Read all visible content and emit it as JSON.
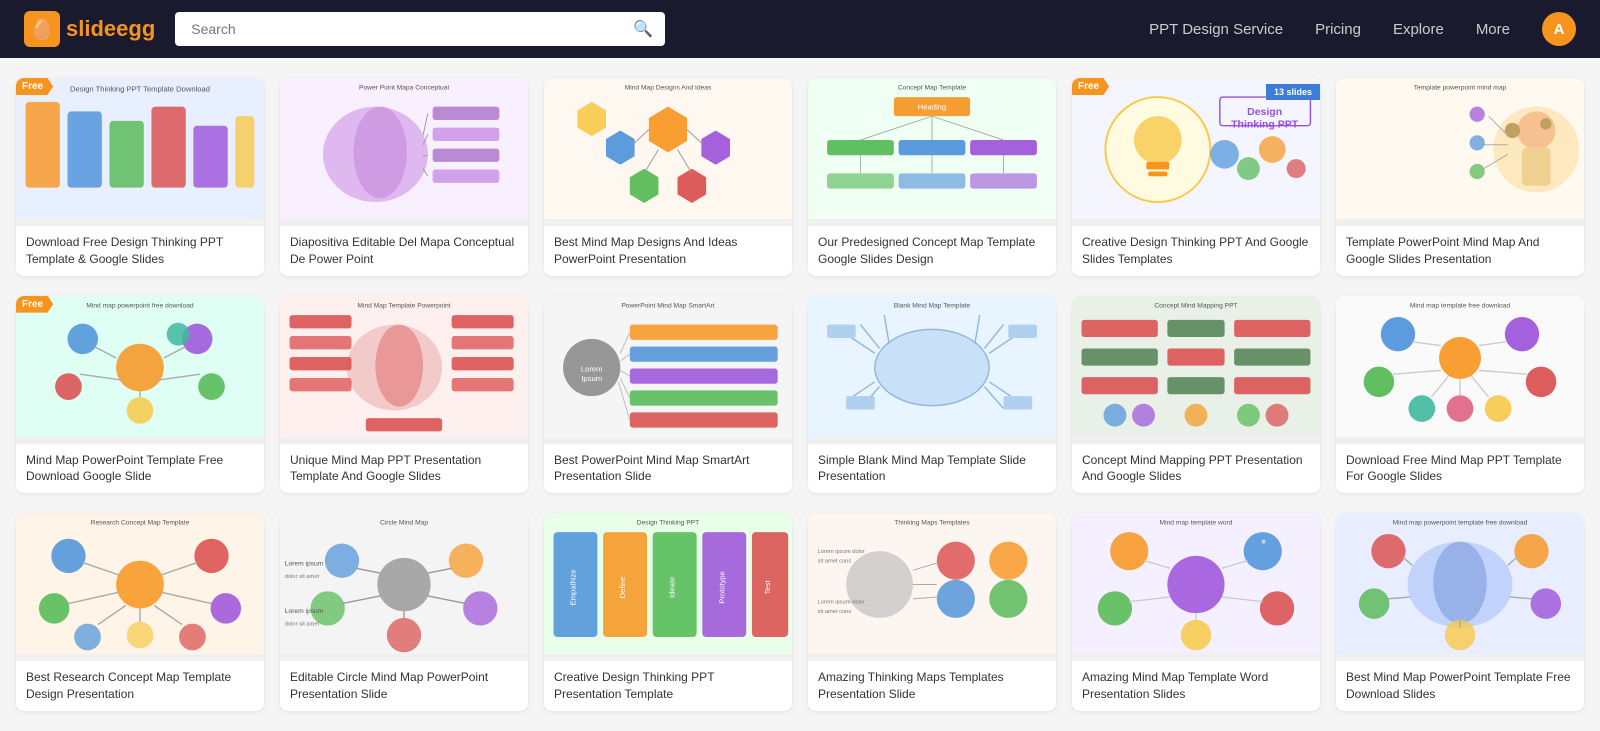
{
  "header": {
    "logo_text_slide": "slide",
    "logo_text_egg": "egg",
    "search_placeholder": "Search",
    "nav": {
      "ppt_design": "PPT Design Service",
      "pricing": "Pricing",
      "explore": "Explore",
      "more": "More"
    },
    "user_initial": "A"
  },
  "cards": [
    {
      "title": "Download Free Design Thinking PPT Template & Google Slides",
      "badge": "Free",
      "bg": "#f0f4ff"
    },
    {
      "title": "Diapositiva Editable Del Mapa Conceptual De Power Point",
      "badge": "",
      "bg": "#f9f0ff"
    },
    {
      "title": "Best Mind Map Designs And Ideas PowerPoint Presentation",
      "badge": "",
      "bg": "#fff8f0"
    },
    {
      "title": "Our Predesigned Concept Map Template Google Slides Design",
      "badge": "",
      "bg": "#f0fff4"
    },
    {
      "title": "Creative Design Thinking PPT And Google Slides Templates",
      "badge": "Free",
      "badge_slides": "13 slides",
      "bg": "#f5f5ff"
    },
    {
      "title": "Template PowerPoint Mind Map And Google Slides Presentation",
      "badge": "",
      "bg": "#fff9f0"
    },
    {
      "title": "Mind Map PowerPoint Template Free Download Google Slide",
      "badge": "Free",
      "bg": "#f0fff8"
    },
    {
      "title": "Unique Mind Map PPT Presentation Template And Google Slides",
      "badge": "",
      "bg": "#fff0f0"
    },
    {
      "title": "Best PowerPoint Mind Map SmartArt Presentation Slide",
      "badge": "",
      "bg": "#f5f5f5"
    },
    {
      "title": "Simple Blank Mind Map Template Slide Presentation",
      "badge": "",
      "bg": "#f0f8ff"
    },
    {
      "title": "Concept Mind Mapping PPT Presentation And Google Slides",
      "badge": "",
      "bg": "#f0f4f0"
    },
    {
      "title": "Download Free Mind Map PPT Template For Google Slides",
      "badge": "",
      "bg": "#fafafa"
    },
    {
      "title": "Best Research Concept Map Template Design Presentation",
      "badge": "",
      "bg": "#fff8f5"
    },
    {
      "title": "Editable Circle Mind Map PowerPoint Presentation Slide",
      "badge": "",
      "bg": "#f8f8f8"
    },
    {
      "title": "Creative Design Thinking PPT Presentation Template",
      "badge": "",
      "bg": "#f0f8f0"
    },
    {
      "title": "Amazing Thinking Maps Templates Presentation Slide",
      "badge": "",
      "bg": "#fdf5f0"
    },
    {
      "title": "Amazing Mind Map Template Word Presentation Slides",
      "badge": "",
      "bg": "#f5f0ff"
    },
    {
      "title": "Best Mind Map PowerPoint Template Free Download Slides",
      "badge": "",
      "bg": "#f0f5ff"
    }
  ],
  "thumb_labels": [
    "Design Thinking PPT Template Download",
    "Power Point Mapa Conceptual",
    "Mind Map Designs And Ideas",
    "Concept Map Template",
    "Design Thinking PPT",
    "Template powerpoint mind map",
    "Mind map powerpoint free download",
    "Mind Map Template Powerpoint",
    "PowerPoint Mind Map SmartArt",
    "Blank Mind Map Template",
    "Concept Mind Mapping PPT",
    "Mind map template free download",
    "Research Concept Map Template",
    "Circle Mind Map",
    "Design Thinking PPT",
    "Thinking Maps Templates",
    "Mind map template word",
    "Mind map powerpoint template free download"
  ]
}
